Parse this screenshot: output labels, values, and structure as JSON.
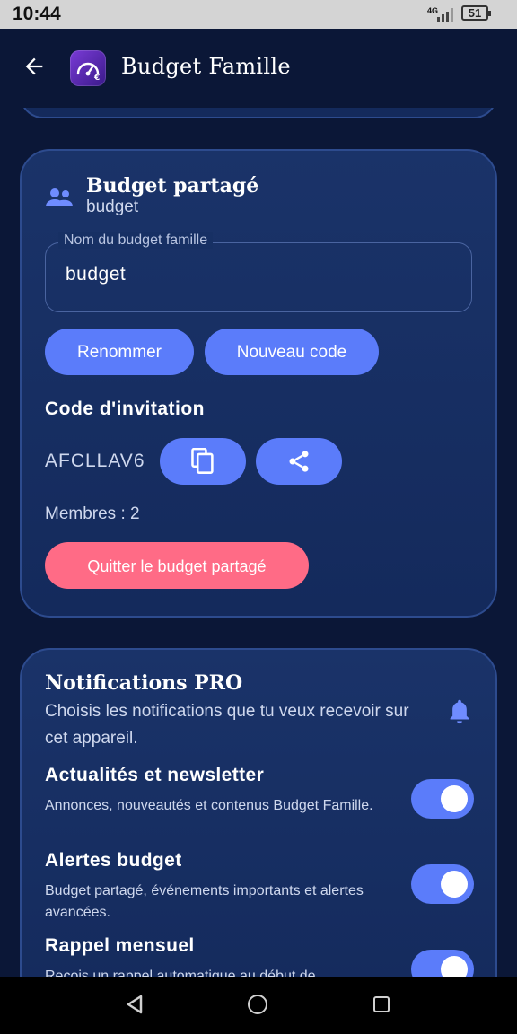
{
  "status": {
    "time": "10:44",
    "network": "4G",
    "battery": "51"
  },
  "appbar": {
    "title": "Budget Famille"
  },
  "shared_budget": {
    "title": "Budget partagé",
    "subtitle": "budget",
    "field_label": "Nom du budget famille",
    "field_value": "budget",
    "rename_label": "Renommer",
    "new_code_label": "Nouveau code",
    "invite_title": "Code d'invitation",
    "invite_code": "AFCLLAV6",
    "members_text": "Membres : 2",
    "quit_label": "Quitter le budget partagé"
  },
  "notifications": {
    "title": "Notifications PRO",
    "description": "Choisis les notifications que tu veux recevoir sur cet appareil.",
    "items": [
      {
        "title": "Actualités et newsletter",
        "description": "Annonces, nouveautés et contenus Budget Famille.",
        "enabled": true
      },
      {
        "title": "Alertes budget",
        "description": "Budget partagé, événements importants et alertes avancées.",
        "enabled": true
      },
      {
        "title": "Rappel mensuel",
        "description": "Reçois un rappel automatique au début de",
        "enabled": true
      }
    ]
  },
  "colors": {
    "accent": "#5b7cfa",
    "danger": "#ff6b86",
    "background": "#0b1737",
    "card": "#173064"
  }
}
